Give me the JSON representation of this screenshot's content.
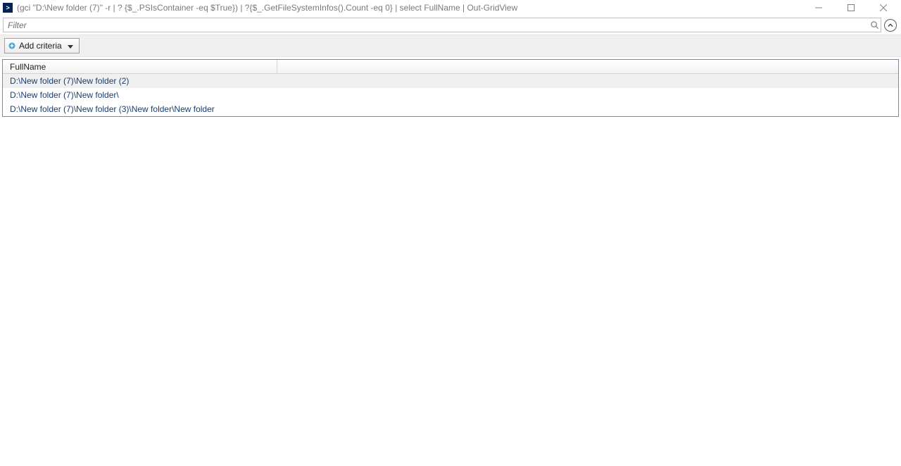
{
  "window": {
    "title": "(gci \"D:\\New folder (7)\" -r | ? {$_.PSIsContainer -eq $True}) | ?{$_.GetFileSystemInfos().Count -eq 0} | select FullName | Out-GridView"
  },
  "filter": {
    "placeholder": "Filter"
  },
  "criteria": {
    "add_label": "Add criteria"
  },
  "grid": {
    "columns": {
      "fullname": "FullName"
    },
    "rows": [
      {
        "fullname": "D:\\New folder (7)\\New folder (2)"
      },
      {
        "fullname": "D:\\New folder (7)\\New folder\\"
      },
      {
        "fullname": "D:\\New folder (7)\\New folder (3)\\New folder\\New folder"
      }
    ]
  }
}
